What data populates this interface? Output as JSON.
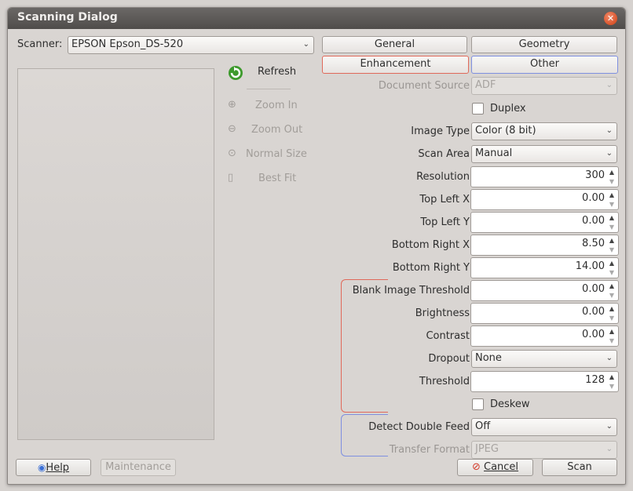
{
  "window": {
    "title": "Scanning Dialog"
  },
  "scanner": {
    "label": "Scanner:",
    "value": "EPSON Epson_DS-520"
  },
  "toolbar": {
    "refresh": "Refresh",
    "zoom_in": "Zoom In",
    "zoom_out": "Zoom Out",
    "normal_size": "Normal Size",
    "best_fit": "Best Fit"
  },
  "tabs": [
    "General",
    "Geometry",
    "Enhancement",
    "Other"
  ],
  "fields": {
    "document_source": {
      "label": "Document Source",
      "value": "ADF"
    },
    "duplex": {
      "label": "Duplex"
    },
    "image_type": {
      "label": "Image Type",
      "value": "Color (8 bit)"
    },
    "scan_area": {
      "label": "Scan Area",
      "value": "Manual"
    },
    "resolution": {
      "label": "Resolution",
      "value": "300"
    },
    "top_left_x": {
      "label": "Top Left X",
      "value": "0.00"
    },
    "top_left_y": {
      "label": "Top Left Y",
      "value": "0.00"
    },
    "bottom_right_x": {
      "label": "Bottom Right X",
      "value": "8.50"
    },
    "bottom_right_y": {
      "label": "Bottom Right Y",
      "value": "14.00"
    },
    "blank_threshold": {
      "label": "Blank Image Threshold",
      "value": "0.00"
    },
    "brightness": {
      "label": "Brightness",
      "value": "0.00"
    },
    "contrast": {
      "label": "Contrast",
      "value": "0.00"
    },
    "dropout": {
      "label": "Dropout",
      "value": "None"
    },
    "threshold": {
      "label": "Threshold",
      "value": "128"
    },
    "deskew": {
      "label": "Deskew"
    },
    "detect_double_feed": {
      "label": "Detect Double Feed",
      "value": "Off"
    },
    "transfer_format": {
      "label": "Transfer Format",
      "value": "JPEG"
    }
  },
  "buttons": {
    "help": "Help",
    "maintenance": "Maintenance",
    "cancel": "Cancel",
    "scan": "Scan"
  },
  "colors": {
    "enhancement_accent": "#e0695a",
    "other_accent": "#7e8fe0"
  }
}
